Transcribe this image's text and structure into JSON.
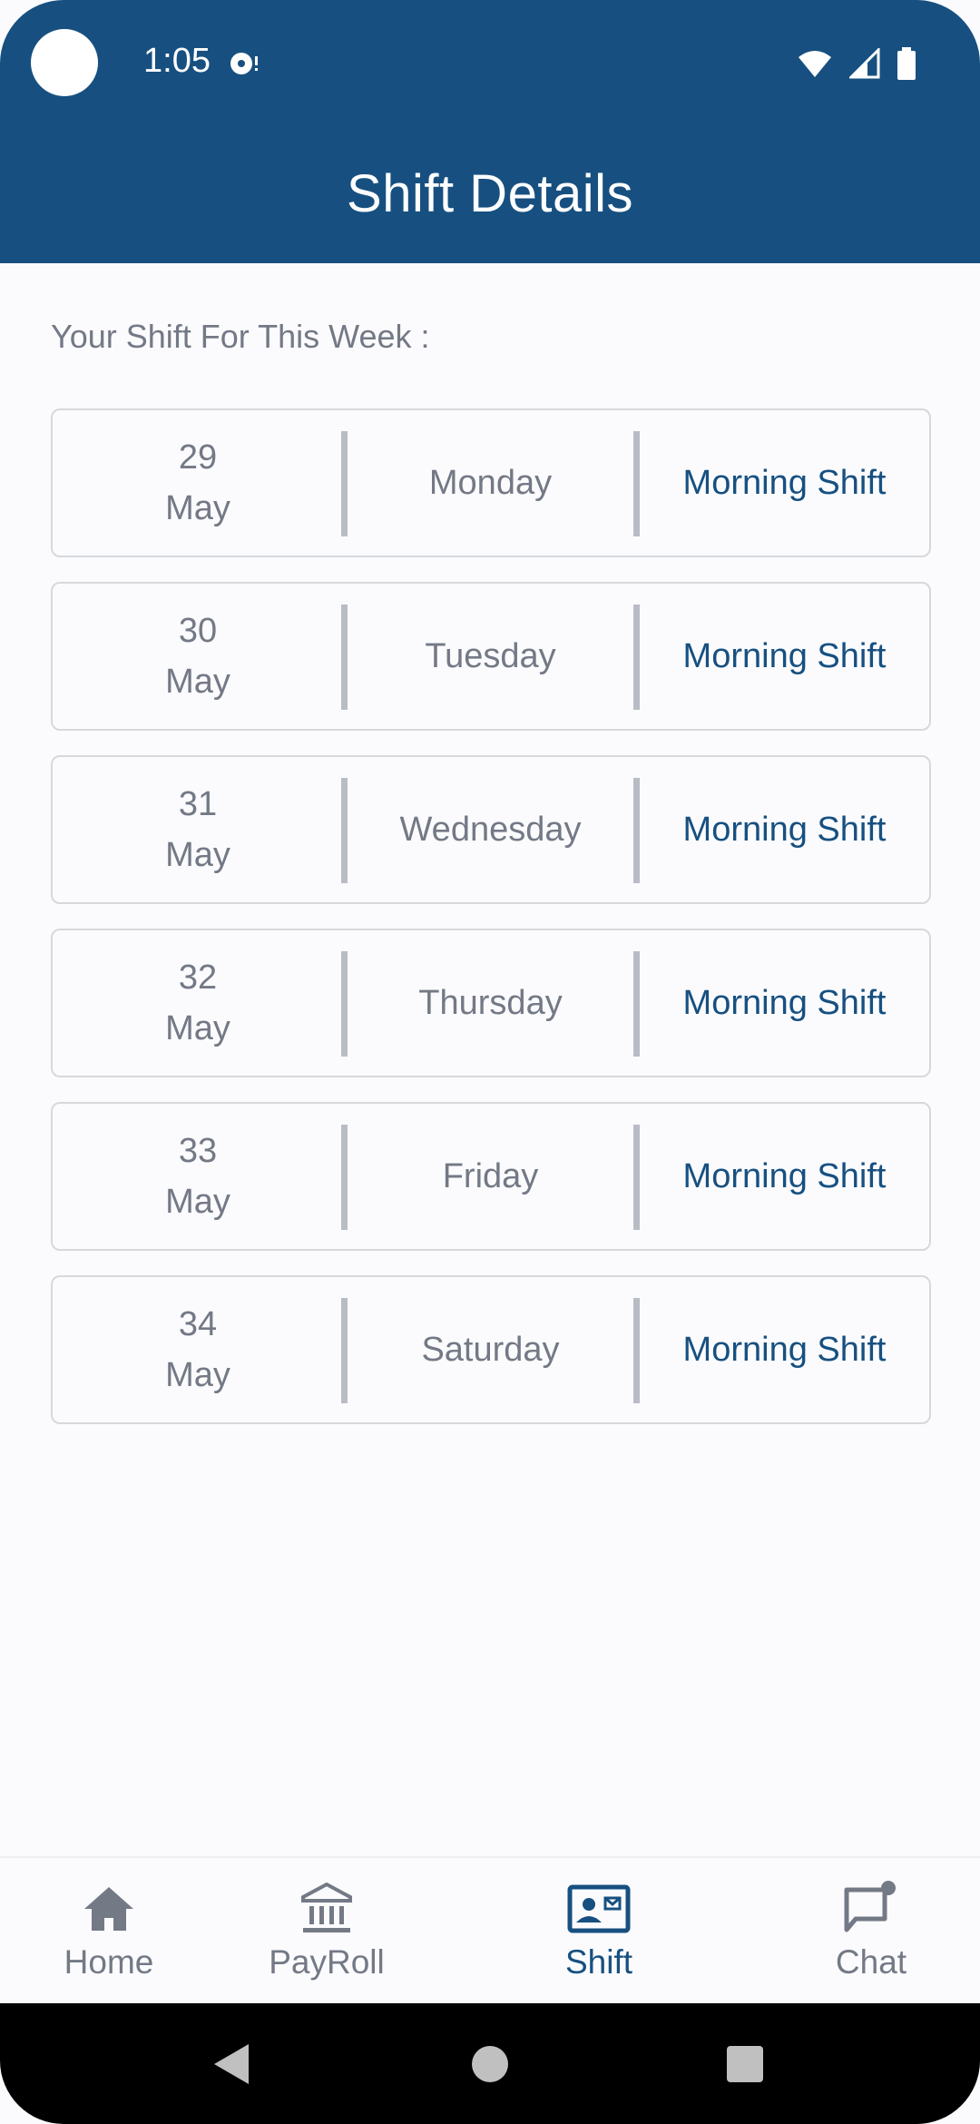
{
  "status_bar": {
    "time": "1:05"
  },
  "header": {
    "title": "Shift Details"
  },
  "week_label": "Your Shift For This Week :",
  "shifts": [
    {
      "date": "29",
      "month": "May",
      "day": "Monday",
      "shift": "Morning Shift"
    },
    {
      "date": "30",
      "month": "May",
      "day": "Tuesday",
      "shift": "Morning Shift"
    },
    {
      "date": "31",
      "month": "May",
      "day": "Wednesday",
      "shift": "Morning Shift"
    },
    {
      "date": "32",
      "month": "May",
      "day": "Thursday",
      "shift": "Morning Shift"
    },
    {
      "date": "33",
      "month": "May",
      "day": "Friday",
      "shift": "Morning Shift"
    },
    {
      "date": "34",
      "month": "May",
      "day": "Saturday",
      "shift": "Morning Shift"
    }
  ],
  "bottom_nav": {
    "items": [
      {
        "label": "Home",
        "icon": "home-icon"
      },
      {
        "label": "PayRoll",
        "icon": "bank-icon"
      },
      {
        "label": "Shift",
        "icon": "contact-card-icon",
        "active": true
      },
      {
        "label": "Chat",
        "icon": "chat-notification-icon"
      }
    ]
  },
  "colors": {
    "primary": "#175080",
    "text_muted": "#737985",
    "background": "#fbfbfe"
  }
}
